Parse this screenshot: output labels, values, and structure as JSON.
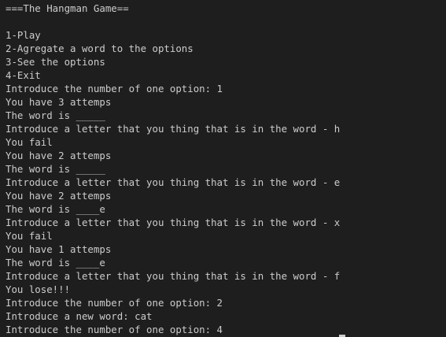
{
  "terminal": {
    "partial_top_line": "                                        ·  · ·      ",
    "lines": [
      "===The Hangman Game==",
      "",
      "1-Play",
      "2-Agregate a word to the options",
      "3-See the options",
      "4-Exit",
      "Introduce the number of one option: 1",
      "You have 3 attemps",
      "The word is _____",
      "Introduce a letter that you thing that is in the word - h",
      "You fail",
      "You have 2 attemps",
      "The word is _____",
      "Introduce a letter that you thing that is in the word - e",
      "You have 2 attemps",
      "The word is ____e",
      "Introduce a letter that you thing that is in the word - x",
      "You fail",
      "You have 1 attemps",
      "The word is ____e",
      "Introduce a letter that you thing that is in the word - f",
      "You lose!!!",
      "Introduce the number of one option: 2",
      "Introduce a new word: cat",
      "Introduce the number of one option: 4"
    ]
  }
}
